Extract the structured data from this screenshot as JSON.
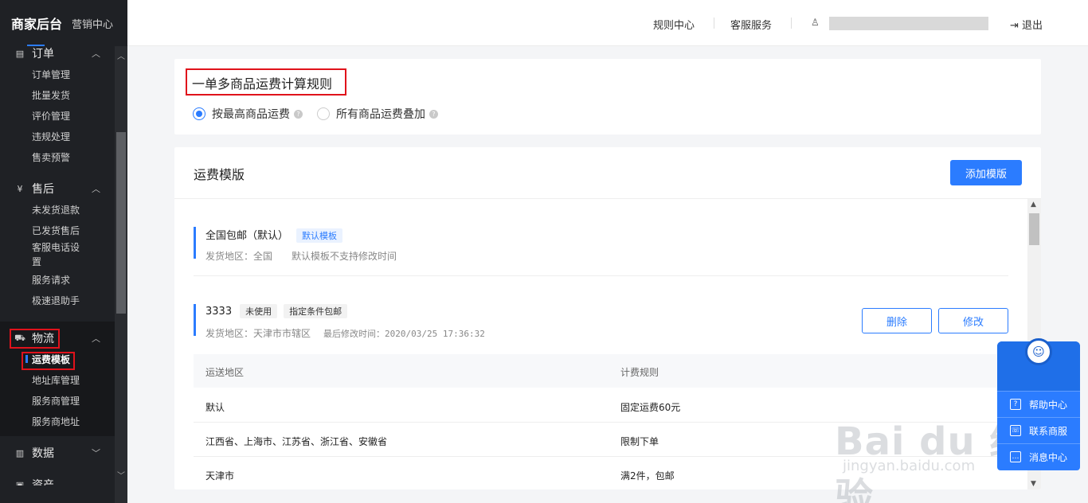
{
  "sidebar": {
    "brand_main": "商家后台",
    "brand_sub": "营销中心",
    "groups": {
      "order": {
        "icon": "order-doc-icon",
        "title": "订单",
        "items": [
          "订单管理",
          "批量发货",
          "评价管理",
          "违规处理",
          "售卖预警"
        ]
      },
      "aftersale": {
        "icon": "yen-icon",
        "title": "售后",
        "items": [
          "未发货退款",
          "已发货售后",
          "客服电话设置",
          "服务请求",
          "极速退助手"
        ]
      },
      "logistics": {
        "icon": "truck-icon",
        "title": "物流",
        "items": [
          "运费模板",
          "地址库管理",
          "服务商管理",
          "服务商地址"
        ],
        "active": "运费模板"
      },
      "data": {
        "icon": "bar-chart-icon",
        "title": "数据"
      },
      "asset": {
        "title": "资产"
      }
    },
    "aftersale_item3_line1": "客服电话设",
    "aftersale_item3_line2": "置"
  },
  "header": {
    "rules_center": "规则中心",
    "customer_service": "客服服务",
    "logout": "退出"
  },
  "freight_rule": {
    "title": "一单多商品运费计算规则",
    "options": [
      "按最高商品运费",
      "所有商品运费叠加"
    ],
    "selected": "按最高商品运费"
  },
  "templates": {
    "title": "运费模版",
    "add_button": "添加模版",
    "list": [
      {
        "name": "全国包邮（默认）",
        "tags": [
          "默认模板"
        ],
        "meta": "发货地区：全国　　默认模板不支持修改时间"
      },
      {
        "name": "3333",
        "tags": [
          "未使用",
          "指定条件包邮"
        ],
        "meta_area": "发货地区：天津市市辖区",
        "meta_time": "最后修改时间：2020/03/25 17:36:32",
        "delete": "删除",
        "edit": "修改"
      }
    ],
    "table": {
      "headers": [
        "运送地区",
        "计费规则"
      ],
      "rows": [
        [
          "默认",
          "固定运费60元"
        ],
        [
          "江西省、上海市、江苏省、浙江省、安徽省",
          "限制下单"
        ],
        [
          "天津市",
          "满2件，包邮"
        ]
      ]
    }
  },
  "help_panel": {
    "items": [
      "帮助中心",
      "联系商服",
      "消息中心"
    ]
  },
  "watermark": {
    "main": "Bai du 经验",
    "sub": "jingyan.baidu.com"
  },
  "colors": {
    "primary": "#2b7cff",
    "sidebar_bg": "#1f2125",
    "highlight_border": "#e0121b"
  }
}
